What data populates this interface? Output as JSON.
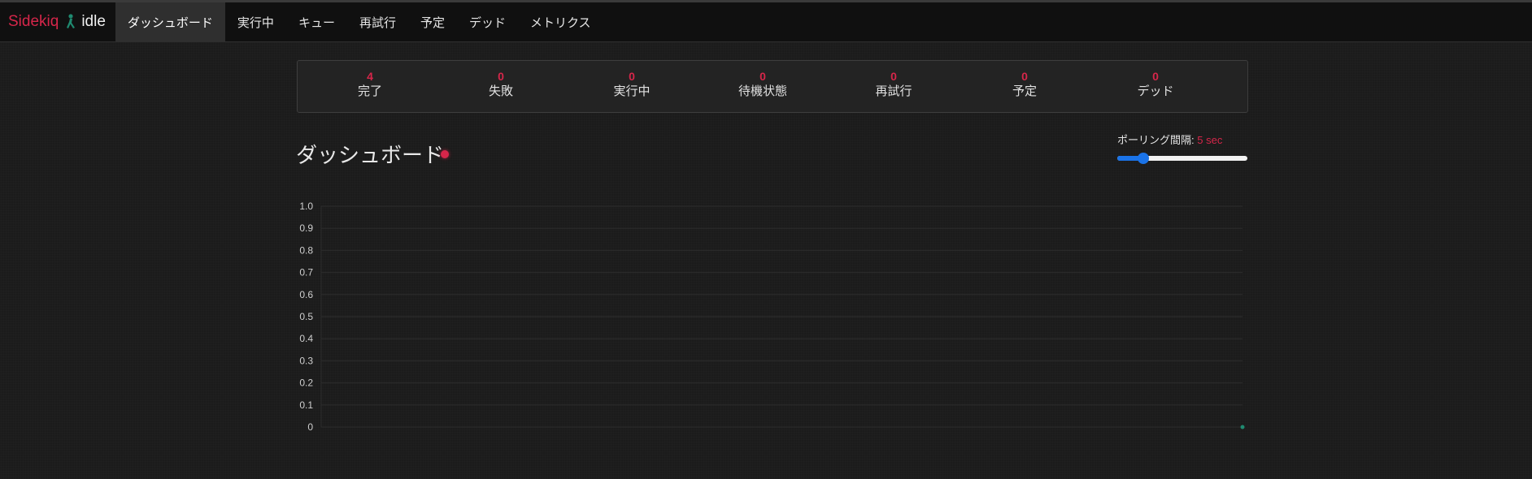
{
  "navbar": {
    "brand": "Sidekiq",
    "status": "idle",
    "items": [
      {
        "label": "ダッシュボード",
        "active": true
      },
      {
        "label": "実行中",
        "active": false
      },
      {
        "label": "キュー",
        "active": false
      },
      {
        "label": "再試行",
        "active": false
      },
      {
        "label": "予定",
        "active": false
      },
      {
        "label": "デッド",
        "active": false
      },
      {
        "label": "メトリクス",
        "active": false
      }
    ]
  },
  "summary": [
    {
      "count": "4",
      "label": "完了"
    },
    {
      "count": "0",
      "label": "失敗"
    },
    {
      "count": "0",
      "label": "実行中"
    },
    {
      "count": "0",
      "label": "待機状態"
    },
    {
      "count": "0",
      "label": "再試行"
    },
    {
      "count": "0",
      "label": "予定"
    },
    {
      "count": "0",
      "label": "デッド"
    }
  ],
  "dashboard": {
    "title": "ダッシュボード"
  },
  "polling": {
    "label": "ポーリング間隔:",
    "value": "5 sec",
    "slider_fraction": 0.2
  },
  "colors": {
    "accent": "#d6264a",
    "slider": "#1a73e8",
    "point": "#1f8a70"
  },
  "chart_data": {
    "type": "line",
    "yticks": [
      "1.0",
      "0.9",
      "0.8",
      "0.7",
      "0.6",
      "0.5",
      "0.4",
      "0.3",
      "0.2",
      "0.1",
      "0"
    ],
    "ylim": [
      0,
      1
    ],
    "grid": true,
    "series": [
      {
        "values": [
          0
        ]
      }
    ]
  }
}
